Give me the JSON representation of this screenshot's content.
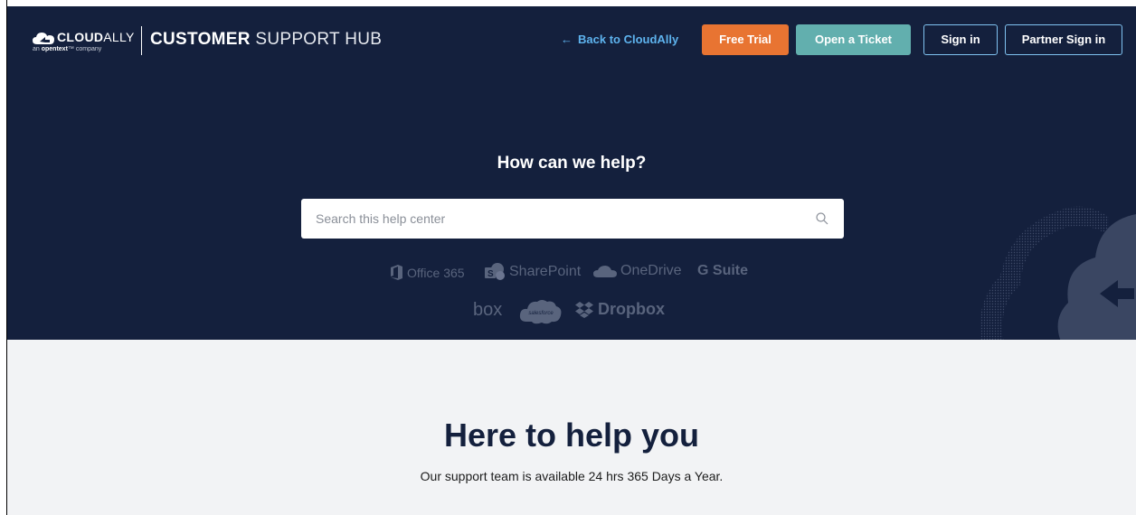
{
  "header": {
    "logo_name_bold": "CLOUD",
    "logo_name_light": "ALLY",
    "logo_sub_prefix": "an ",
    "logo_sub_brand": "opentext",
    "logo_sub_suffix": "™ company",
    "hub_title_bold": "CUSTOMER",
    "hub_title_light": " SUPPORT HUB"
  },
  "nav": {
    "back_arrow": "←",
    "back_label": "Back to CloudAlly",
    "free_trial": "Free Trial",
    "open_ticket": "Open a Ticket",
    "sign_in": "Sign in",
    "partner_sign_in": "Partner Sign in"
  },
  "hero": {
    "headline": "How can we help?",
    "search": {
      "placeholder": "Search this help center",
      "value": ""
    },
    "brands_row1": [
      "Office 365",
      "SharePoint",
      "OneDrive",
      "G Suite"
    ],
    "brands_row2": [
      "box",
      "salesforce",
      "Dropbox"
    ]
  },
  "support": {
    "title": "Here to help you",
    "subtitle": "Our support team is available 24 hrs 365 Days a Year."
  },
  "colors": {
    "hero_bg": "#14203d",
    "free_trial": "#e87432",
    "open_ticket": "#62afae",
    "link_blue": "#5eb3ee",
    "lower_bg": "#f2f3f5"
  },
  "icons": [
    "cloudally-logo-icon",
    "arrow-left-icon",
    "search-icon",
    "office365-icon",
    "sharepoint-icon",
    "onedrive-icon",
    "dropbox-icon",
    "cloud-watermark-icon"
  ]
}
